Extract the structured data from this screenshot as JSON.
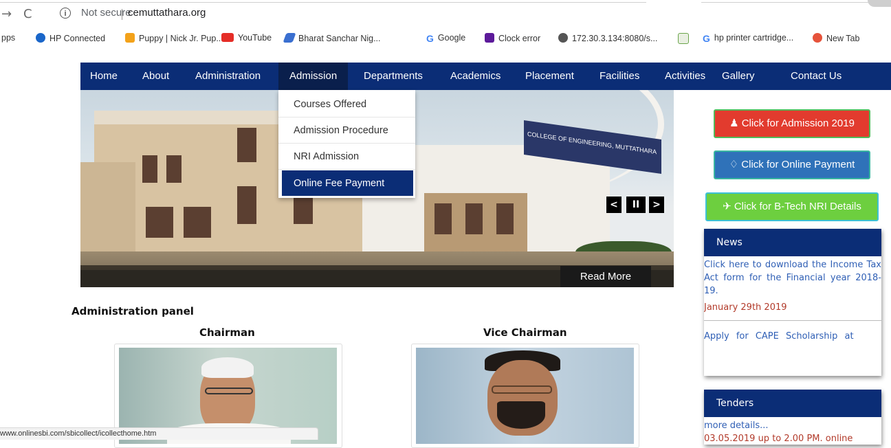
{
  "browser": {
    "back_arrow": "→",
    "reload": "C",
    "security": "Not secure",
    "url": "cemuttathara.org",
    "bookmarks": [
      {
        "label": "pps",
        "icon": "apps-icon",
        "color": ""
      },
      {
        "label": "HP Connected",
        "icon": "hp-icon",
        "color": "#1a66c9"
      },
      {
        "label": "Puppy | Nick Jr. Pup...",
        "icon": "nickjr-icon",
        "color": "#f3a21a"
      },
      {
        "label": "YouTube",
        "icon": "youtube-icon",
        "color": "#e52d27"
      },
      {
        "label": "Bharat Sanchar Nig...",
        "icon": "bsnl-icon",
        "color": "#3a6fd0"
      },
      {
        "label": "Google",
        "icon": "google-icon",
        "color": "#4285f4"
      },
      {
        "label": "Clock error",
        "icon": "yahoo-icon",
        "color": "#5c1a9a"
      },
      {
        "label": "172.30.3.134:8080/s...",
        "icon": "globe-icon",
        "color": "#555555"
      },
      {
        "label": "",
        "icon": "chart-icon",
        "color": "#6aa54a"
      },
      {
        "label": "hp printer cartridge...",
        "icon": "google-icon",
        "color": "#4285f4"
      },
      {
        "label": "New Tab",
        "icon": "newtab-icon",
        "color": "#e6533b"
      }
    ]
  },
  "nav": {
    "items": [
      "Home",
      "About",
      "Administration",
      "Admission",
      "Departments",
      "Academics",
      "Placement",
      "Facilities",
      "Activities",
      "Gallery",
      "Contact Us"
    ],
    "active": "Admission"
  },
  "dropdown": {
    "items": [
      "Courses Offered",
      "Admission Procedure",
      "NRI Admission",
      "Online Fee Payment"
    ],
    "active": "Online Fee Payment"
  },
  "slider": {
    "sign_text": "COLLEGE OF ENGINEERING, MUTTATHARA",
    "read_more": "Read More",
    "prev": "<",
    "pause": "II",
    "next": ">"
  },
  "buttons": {
    "admission": "Click for Admission 2019",
    "payment": "Click for Online Payment",
    "nri": "Click for B-Tech NRI Details"
  },
  "news": {
    "title": "News",
    "item1": "Click here to download the Income Tax Act form for the Financial year 2018-19.",
    "date1": "January 29th 2019",
    "item2": "Apply for CAPE Scholarship at"
  },
  "tenders": {
    "title": "Tenders",
    "item1": "more details...",
    "item2": "03.05.2019 up to 2.00 PM. online"
  },
  "admin": {
    "heading": "Administration panel",
    "chairman": "Chairman",
    "vice_chairman": "Vice Chairman"
  },
  "status_url": "www.onlinesbi.com/sbicollect/icollecthome.htm",
  "colors": {
    "nav_bg": "#0b2d76",
    "nav_active": "#0a1f4c",
    "btn_admission": "#e23b2e",
    "btn_payment": "#2f72b9",
    "btn_nri": "#6dcf3f",
    "news_link": "#2f5fb5",
    "news_date": "#b23a2a"
  }
}
